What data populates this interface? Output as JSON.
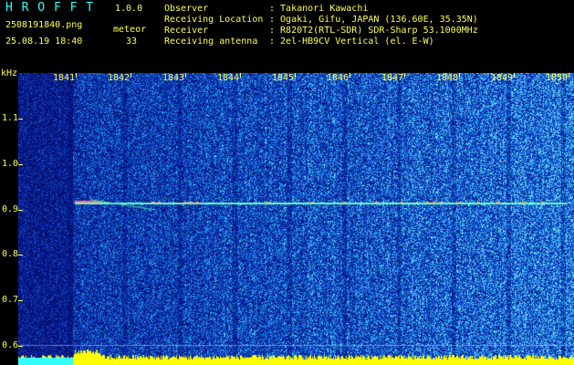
{
  "header": {
    "logo": "H R O F F T",
    "version": "1.0.0",
    "filename": "2508191840.png",
    "datetime": "25.08.19 18:40",
    "event_label": "meteor",
    "event_count": "33",
    "info": [
      {
        "label": "Observer",
        "value": ": Takanori Kawachi"
      },
      {
        "label": "Receiving Location",
        "value": ": Ogaki, Gifu, JAPAN (136.60E, 35.35N)"
      },
      {
        "label": "Receiver",
        "value": ": R820T2(RTL-SDR) SDR-Sharp 53.1000MHz"
      },
      {
        "label": "Receiving antenna",
        "value": ": 2el-HB9CV Vertical (el. E-W)"
      }
    ]
  },
  "axes": {
    "y_unit": "kHz",
    "y_ticks": [
      "1.1",
      "1.0",
      "0.9",
      "0.8",
      "0.7",
      "0.6"
    ],
    "x_ticks": [
      "1841",
      "1842",
      "1843",
      "1844",
      "1845",
      "1846",
      "1847",
      "1848",
      "1849",
      "1850"
    ]
  },
  "colors": {
    "label_yellow": "#ffff55",
    "label_cyan": "#33ffff",
    "background_blue": "#0a1a8c",
    "noise_floor": "#ffff00",
    "meteor_trace": "#ff6688"
  },
  "spectrogram": {
    "meteor_trace_freq_khz": 0.915,
    "meteor_start_minute": 1841
  }
}
